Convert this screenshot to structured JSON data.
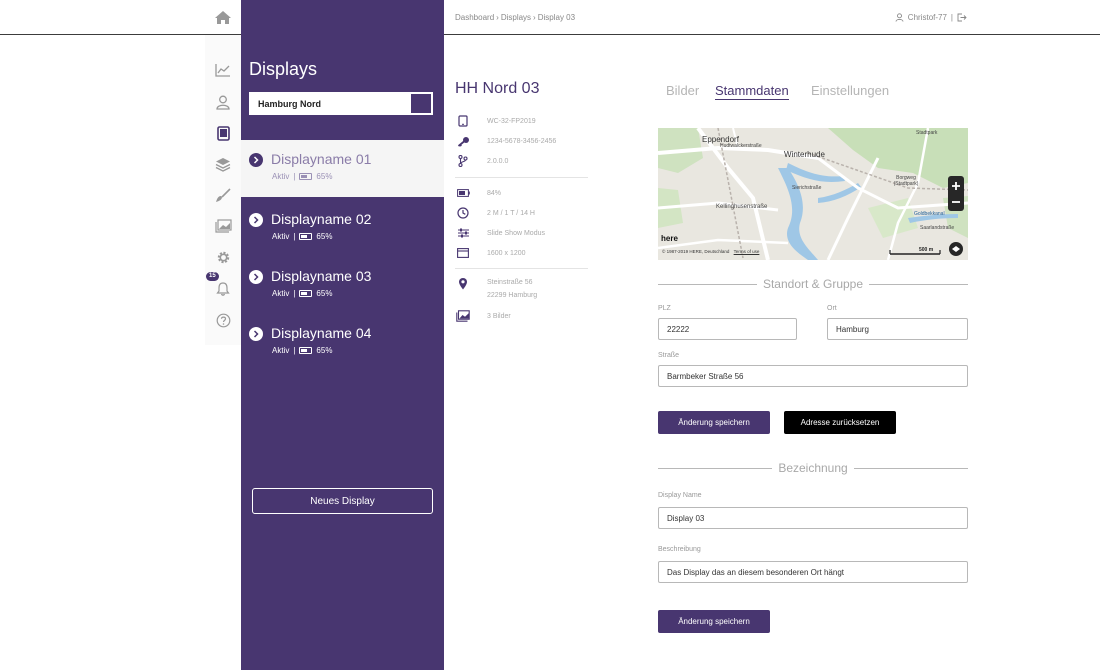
{
  "breadcrumb": {
    "items": [
      "Dashboard",
      "Displays",
      "Display 03"
    ],
    "separator": "›"
  },
  "user": {
    "name": "Christof-77",
    "separator": "|"
  },
  "rail": {
    "notification_count": "15"
  },
  "sidebar": {
    "title": "Displays",
    "search_value": "Hamburg Nord",
    "items": [
      {
        "name": "Displayname 01",
        "status": "Aktiv",
        "sep": "|",
        "battery": "65%"
      },
      {
        "name": "Displayname 02",
        "status": "Aktiv",
        "sep": "|",
        "battery": "65%"
      },
      {
        "name": "Displayname 03",
        "status": "Aktiv",
        "sep": "|",
        "battery": "65%"
      },
      {
        "name": "Displayname 04",
        "status": "Aktiv",
        "sep": "|",
        "battery": "65%"
      }
    ],
    "new_button": "Neues Display"
  },
  "info": {
    "title": "HH Nord 03",
    "device_id": "WC-32-FP2019",
    "license_key": "1234-5678-3456-2456",
    "version": "2.0.0.0",
    "battery": "84%",
    "schedule": "2 M / 1 T / 14 H",
    "mode": "Slide Show Modus",
    "resolution": "1600 x 1200",
    "address_line1": "Steinstraße 56",
    "address_line2": "22299 Hamburg",
    "images": "3 Bilder"
  },
  "tabs": [
    {
      "label": "Bilder"
    },
    {
      "label": "Stammdaten"
    },
    {
      "label": "Einstellungen"
    }
  ],
  "map": {
    "labels": {
      "eppendorf": "Eppendorf",
      "winterhude": "Winterhude",
      "hudtwalcker": "Hudtwalckerstraße",
      "sierich": "Sierichstraße",
      "borgweg": "Borgweg (Stadtpark)",
      "kellinghusen": "Kellinghusenstraße",
      "saarland": "Saarlandstraße",
      "stadtpark": "Stadtpark",
      "goldbek": "Goldbekkanal",
      "here": "here",
      "copyright": "© 1987-2019 HERE, Deutschland",
      "terms": "Terms of use",
      "scale": "500 m"
    }
  },
  "standort": {
    "heading": "Standort & Gruppe",
    "plz_label": "PLZ",
    "plz_value": "22222",
    "ort_label": "Ort",
    "ort_value": "Hamburg",
    "strasse_label": "Straße",
    "strasse_value": "Barmbeker Straße 56",
    "save_button": "Änderung speichern",
    "reset_button": "Adresse zurücksetzen"
  },
  "bezeichnung": {
    "heading": "Bezeichnung",
    "name_label": "Display Name",
    "name_value": "Display 03",
    "desc_label": "Beschreibung",
    "desc_value": "Das Display das an diesem besonderen Ort hängt",
    "save_button": "Änderung speichern"
  },
  "colors": {
    "brand": "#483670",
    "dark_button": "#000000",
    "active_item_bg": "#f5f5f5"
  }
}
